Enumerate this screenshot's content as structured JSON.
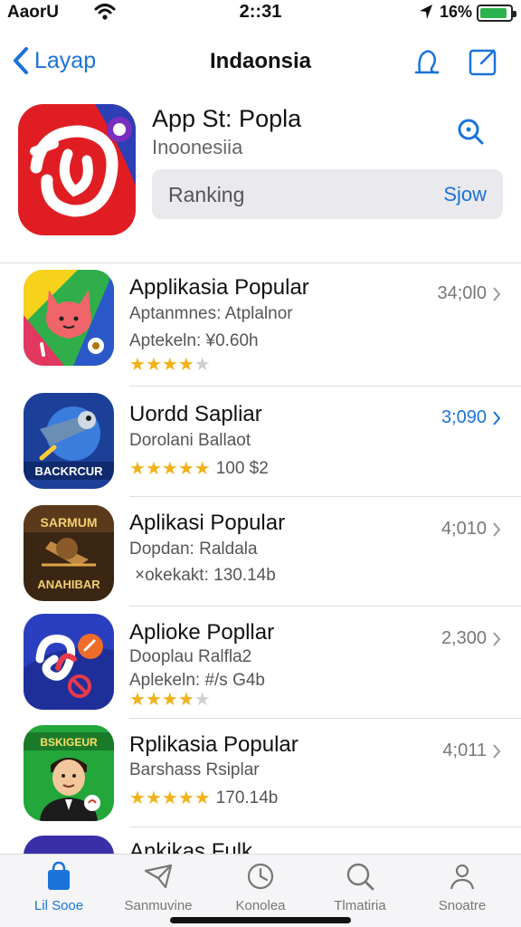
{
  "status": {
    "carrier": "AaorU",
    "time": "2::31",
    "battery_pct": "16%",
    "battery_level": 0.9,
    "battery_color": "#2bb24c"
  },
  "nav": {
    "back_label": "Layap",
    "title": "Indaonsia"
  },
  "header": {
    "title": "App St: Popla",
    "subtitle": "Inoonesiia",
    "ranking_label": "Ranking",
    "show_label": "Sjow"
  },
  "apps": [
    {
      "name": "Applikasia Popular",
      "sub1": "Aptanmnes: Atplalnor",
      "sub2": "Aptekeln: ¥0.60h",
      "stars": 4,
      "meta": "",
      "price": "34;0l0"
    },
    {
      "name": "Uordd Sapliar",
      "sub1": "Dorolani Ballaot",
      "sub2": "",
      "stars": 4.5,
      "meta": "100 $2",
      "price": "3;090",
      "price_blue": true
    },
    {
      "name": "Aplikasi Popular",
      "sub1": "Dopdan: Raldala",
      "sub2": "",
      "stars": 0,
      "meta": "×okekakt: 130.14b",
      "price": "4;010"
    },
    {
      "name": "Aplioke Popllar",
      "sub1": "Dooplau Ralfla2",
      "sub2": "Aplekeln: #/s G4b",
      "stars": 4,
      "meta": "",
      "price": "2,300"
    },
    {
      "name": "Rplikasia Popular",
      "sub1": "Barshass Rsiplar",
      "sub2": "",
      "stars": 4.5,
      "meta": "170.14b",
      "price": "4;011"
    },
    {
      "name": "Ankikas Fulk",
      "sub1": "",
      "sub2": "",
      "stars": 0,
      "meta": "",
      "price": ""
    }
  ],
  "app_icon_texts": {
    "icon2": "BACKRCUR",
    "icon3_top": "SARMUM",
    "icon3_bottom": "ANAHIBAR",
    "icon5": "BSKIGEUR"
  },
  "tabs": [
    {
      "label": "Lil Sooe",
      "icon": "bag-icon",
      "active": true
    },
    {
      "label": "Sanmuvine",
      "icon": "send-icon",
      "active": false
    },
    {
      "label": "Konolea",
      "icon": "clock-icon",
      "active": false
    },
    {
      "label": "Tlmatiria",
      "icon": "search-icon",
      "active": false
    },
    {
      "label": "Snoatre",
      "icon": "person-icon",
      "active": false
    }
  ],
  "colors": {
    "accent": "#1a73d9",
    "star": "#f2b21b"
  }
}
